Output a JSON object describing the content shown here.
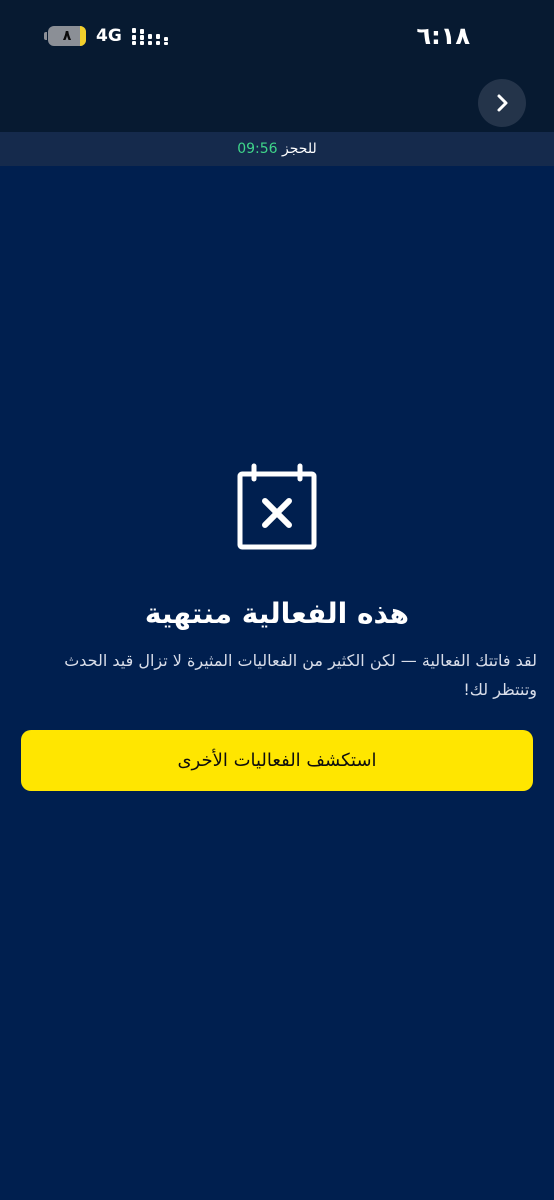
{
  "status_bar": {
    "time": "٦:١٨",
    "network": "4G",
    "battery_level": "٨",
    "battery_color": "#f2cf2b"
  },
  "header": {
    "back_icon": "chevron-right-icon"
  },
  "booking_timer": {
    "label": "للحجز",
    "time": "09:56",
    "time_color": "#3fd58a"
  },
  "empty_state": {
    "icon": "calendar-x-icon",
    "title": "هذه الفعالية منتهية",
    "message": "لقد فاتتك الفعالية — لكن الكثير من الفعاليات المثيرة لا تزال قيد الحدث وتنتظر لك!"
  },
  "actions": {
    "explore_label": "استكشف الفعاليات الأخرى",
    "explore_color": "#ffe600"
  },
  "theme": {
    "background": "#001f4f",
    "header_background": "#071a31"
  }
}
